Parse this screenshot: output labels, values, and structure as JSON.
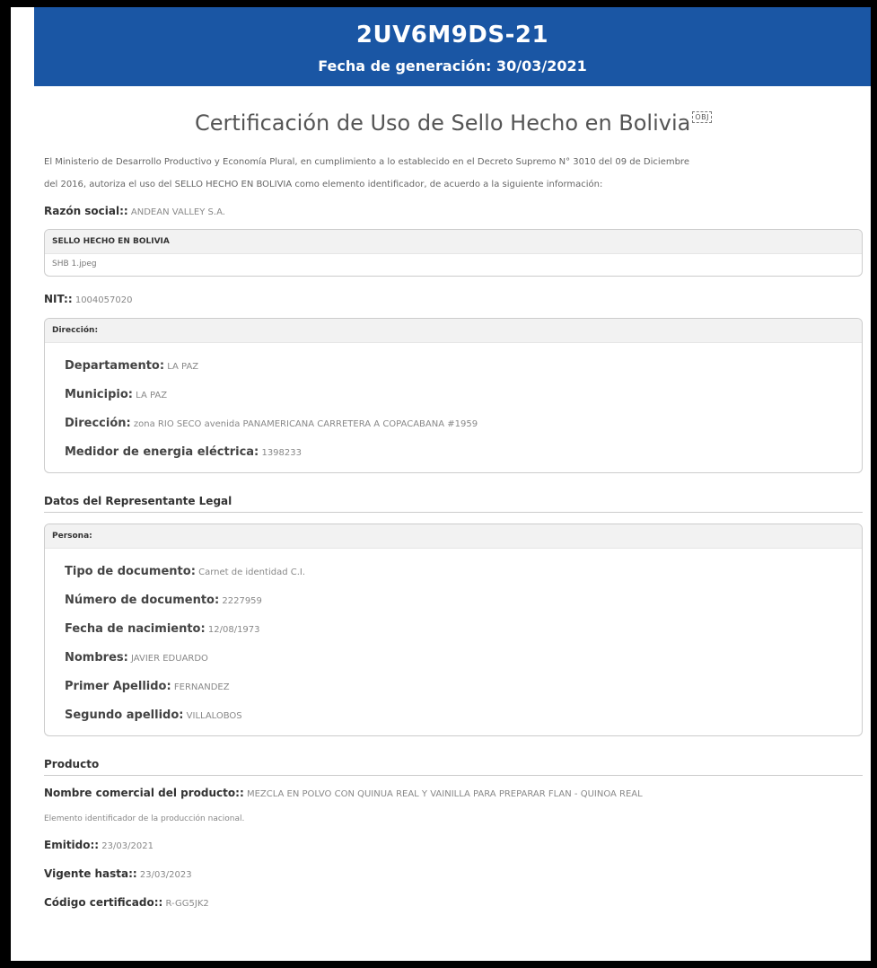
{
  "header": {
    "code": "2UV6M9DS-21",
    "date_line": "Fecha de generación: 30/03/2021"
  },
  "title": "Certificación de Uso de Sello Hecho en Bolivia",
  "title_badge": "OBJ",
  "intro_line1": "El Ministerio de Desarrollo Productivo y Economía Plural, en cumplimiento a lo establecido en el Decreto Supremo N° 3010 del 09 de Diciembre",
  "intro_line2": "del 2016, autoriza el uso del SELLO HECHO EN BOLIVIA como elemento identificador, de acuerdo a la siguiente información:",
  "razon_social": {
    "label": "Razón social::",
    "value": "ANDEAN VALLEY S.A."
  },
  "sello": {
    "title": "SELLO HECHO EN BOLIVIA",
    "file": "SHB 1.jpeg"
  },
  "nit": {
    "label": "NIT::",
    "value": "1004057020"
  },
  "direccion": {
    "title": "Dirección:",
    "fields": [
      {
        "label": "Departamento:",
        "value": "LA PAZ"
      },
      {
        "label": "Municipio:",
        "value": "LA PAZ"
      },
      {
        "label": "Dirección:",
        "value": "zona RIO SECO avenida PANAMERICANA CARRETERA A COPACABANA #1959"
      },
      {
        "label": "Medidor de energia eléctrica:",
        "value": "1398233"
      }
    ]
  },
  "representante": {
    "section": "Datos del Representante Legal",
    "title": "Persona:",
    "fields": [
      {
        "label": "Tipo de documento:",
        "value": "Carnet de identidad C.I."
      },
      {
        "label": "Número de documento:",
        "value": "2227959"
      },
      {
        "label": "Fecha de nacimiento:",
        "value": "12/08/1973"
      },
      {
        "label": "Nombres:",
        "value": "JAVIER EDUARDO"
      },
      {
        "label": "Primer Apellido:",
        "value": "FERNANDEZ"
      },
      {
        "label": "Segundo apellido:",
        "value": "VILLALOBOS"
      }
    ]
  },
  "producto": {
    "section": "Producto",
    "nombre": {
      "label": "Nombre comercial del producto::",
      "value": "MEZCLA EN POLVO CON QUINUA REAL Y VAINILLA PARA PREPARAR FLAN - QUINOA REAL"
    },
    "nota": "Elemento identificador de la producción nacional.",
    "emitido": {
      "label": "Emitido::",
      "value": "23/03/2021"
    },
    "vigente": {
      "label": "Vigente hasta::",
      "value": "23/03/2023"
    },
    "codigo": {
      "label": "Código certificado::",
      "value": "R-GG5JK2"
    }
  }
}
